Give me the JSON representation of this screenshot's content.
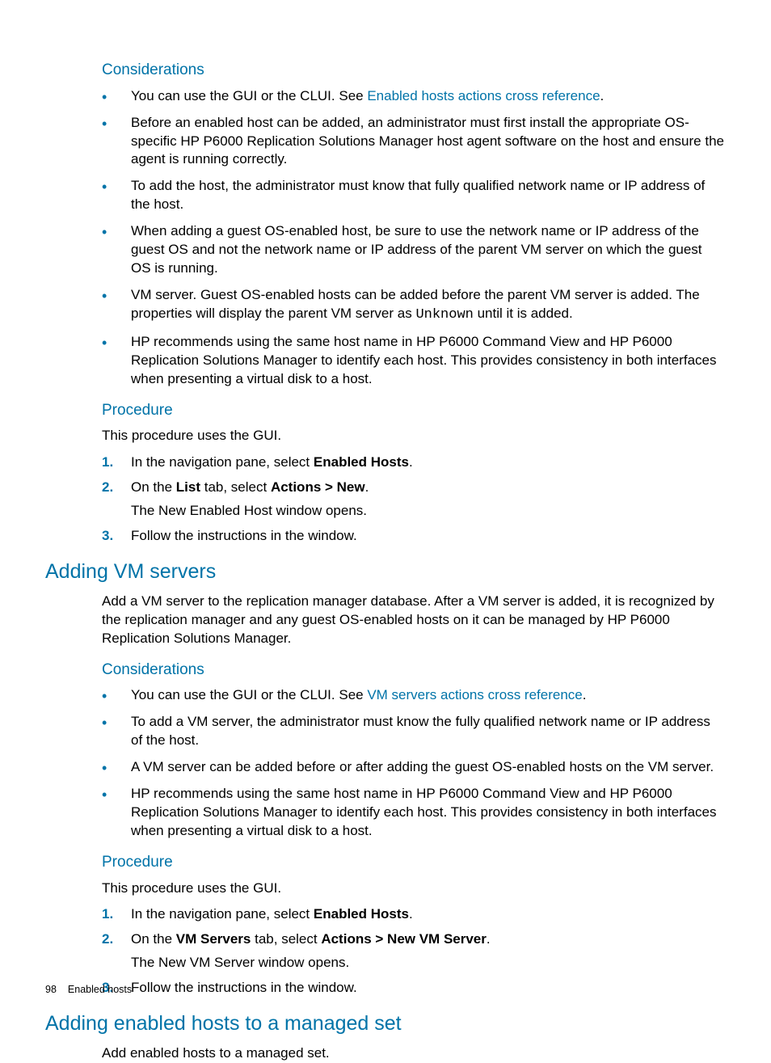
{
  "sec1": {
    "considerations_h": "Considerations",
    "b1_pre": "You can use the GUI or the CLUI. See ",
    "b1_link": "Enabled hosts actions cross reference",
    "b1_post": ".",
    "b2": "Before an enabled host can be added, an administrator must first install the appropriate OS-specific HP P6000 Replication Solutions Manager host agent software on the host and ensure the agent is running correctly.",
    "b3": "To add the host, the administrator must know that fully qualified network name or IP address of the host.",
    "b4": "When adding a guest OS-enabled host, be sure to use the network name or IP address of the guest OS and not the network name or IP address of the parent VM server on which the guest OS is running.",
    "b5_pre": "VM server. Guest OS-enabled hosts can be added before the parent VM server is added. The properties will display the parent VM server as ",
    "b5_mono": "Unknown",
    "b5_post": " until it is added.",
    "b6": "HP recommends using the same host name in HP P6000 Command View and HP P6000 Replication Solutions Manager to identify each host. This provides consistency in both interfaces when presenting a virtual disk to a host.",
    "procedure_h": "Procedure",
    "proc_intro": "This procedure uses the GUI.",
    "s1_pre": "In the navigation pane, select ",
    "s1_b": "Enabled Hosts",
    "s1_post": ".",
    "s2_pre": "On the ",
    "s2_b1": "List",
    "s2_mid": " tab, select ",
    "s2_b2": "Actions > New",
    "s2_post": ".",
    "s2_sub": "The New Enabled Host window opens.",
    "s3": "Follow the instructions in the window."
  },
  "sec2": {
    "heading": "Adding VM servers",
    "intro": "Add a VM server to the replication manager database. After a VM server is added, it is recognized by the replication manager and any guest OS-enabled hosts on it can be managed by HP P6000 Replication Solutions Manager.",
    "considerations_h": "Considerations",
    "b1_pre": "You can use the GUI or the CLUI. See ",
    "b1_link": "VM servers actions cross reference",
    "b1_post": ".",
    "b2": "To add a VM server, the administrator must know the fully qualified network name or IP address of the host.",
    "b3": "A VM server can be added before or after adding the guest OS-enabled hosts on the VM server.",
    "b4": "HP recommends using the same host name in HP P6000 Command View and HP P6000 Replication Solutions Manager to identify each host. This provides consistency in both interfaces when presenting a virtual disk to a host.",
    "procedure_h": "Procedure",
    "proc_intro": "This procedure uses the GUI.",
    "s1_pre": "In the navigation pane, select ",
    "s1_b": "Enabled Hosts",
    "s1_post": ".",
    "s2_pre": "On the ",
    "s2_b1": "VM Servers",
    "s2_mid": " tab, select ",
    "s2_b2": "Actions > New VM Server",
    "s2_post": ".",
    "s2_sub": "The New VM Server window opens.",
    "s3": "Follow the instructions in the window."
  },
  "sec3": {
    "heading": "Adding enabled hosts to a managed set",
    "intro": "Add enabled hosts to a managed set."
  },
  "footer": {
    "page": "98",
    "title": "Enabled hosts"
  }
}
